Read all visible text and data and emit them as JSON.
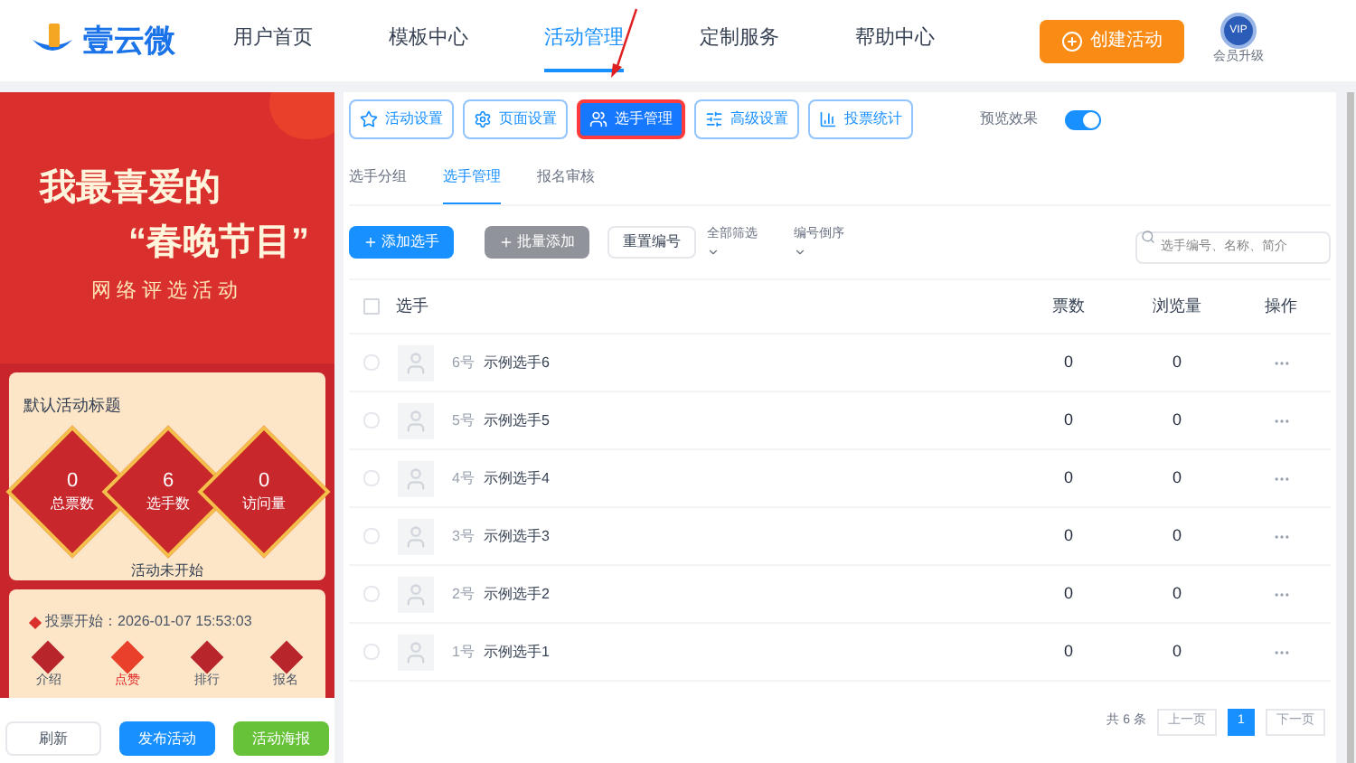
{
  "header": {
    "logo_text": "壹云微",
    "nav": [
      {
        "label": "用户首页",
        "selected": false
      },
      {
        "label": "模板中心",
        "selected": false
      },
      {
        "label": "活动管理",
        "selected": true
      },
      {
        "label": "定制服务",
        "selected": false
      },
      {
        "label": "帮助中心",
        "selected": false
      }
    ],
    "create_button": "创建活动",
    "vip": {
      "badge": "VIP",
      "label": "会员升级"
    }
  },
  "preview": {
    "banner": {
      "title_1": "我最喜爱的",
      "title_2": "“春晚节目”",
      "subtitle": "网络评选活动"
    },
    "card_title": "默认活动标题",
    "stats": [
      {
        "value": "0",
        "label": "总票数"
      },
      {
        "value": "6",
        "label": "选手数"
      },
      {
        "value": "0",
        "label": "访问量"
      }
    ],
    "status": "活动未开始",
    "vote_start": "投票开始：2026-01-07 15:53:03",
    "bottom_nav": [
      {
        "label": "介绍",
        "selected": false
      },
      {
        "label": "点赞",
        "selected": true
      },
      {
        "label": "排行",
        "selected": false
      },
      {
        "label": "报名",
        "selected": false
      }
    ]
  },
  "actions": [
    {
      "label": "刷新",
      "kind": "plain"
    },
    {
      "label": "发布活动",
      "kind": "primary"
    },
    {
      "label": "活动海报",
      "kind": "success"
    }
  ],
  "toolbar": [
    {
      "label": "活动设置",
      "selected": false
    },
    {
      "label": "页面设置",
      "selected": false
    },
    {
      "label": "选手管理",
      "selected": true
    },
    {
      "label": "高级设置",
      "selected": false
    },
    {
      "label": "投票统计",
      "selected": false
    }
  ],
  "preview_toggle": {
    "label": "预览效果",
    "on": true
  },
  "subtabs": [
    {
      "label": "选手分组",
      "selected": false
    },
    {
      "label": "选手管理",
      "selected": true
    },
    {
      "label": "报名审核",
      "selected": false
    }
  ],
  "controls": {
    "add": "添加选手",
    "batch": "批量添加",
    "reset": "重置编号",
    "filter": "全部筛选",
    "sort": "编号倒序",
    "search_placeholder": "选手编号、名称、简介"
  },
  "table": {
    "select_all_checked": false,
    "columns": [
      "选手",
      "票数",
      "浏览量",
      "操作"
    ],
    "rows": [
      {
        "number": "6号",
        "name": "示例选手6",
        "votes": "0",
        "views": "0",
        "checked": false
      },
      {
        "number": "5号",
        "name": "示例选手5",
        "votes": "0",
        "views": "0",
        "checked": false
      },
      {
        "number": "4号",
        "name": "示例选手4",
        "votes": "0",
        "views": "0",
        "checked": false
      },
      {
        "number": "3号",
        "name": "示例选手3",
        "votes": "0",
        "views": "0",
        "checked": false
      },
      {
        "number": "2号",
        "name": "示例选手2",
        "votes": "0",
        "views": "0",
        "checked": false
      },
      {
        "number": "1号",
        "name": "示例选手1",
        "votes": "0",
        "views": "0",
        "checked": false
      }
    ]
  },
  "pagination": {
    "total": "共 6 条",
    "prev": "上一页",
    "pages": [
      {
        "label": "1",
        "selected": true
      }
    ],
    "next": "下一页"
  }
}
